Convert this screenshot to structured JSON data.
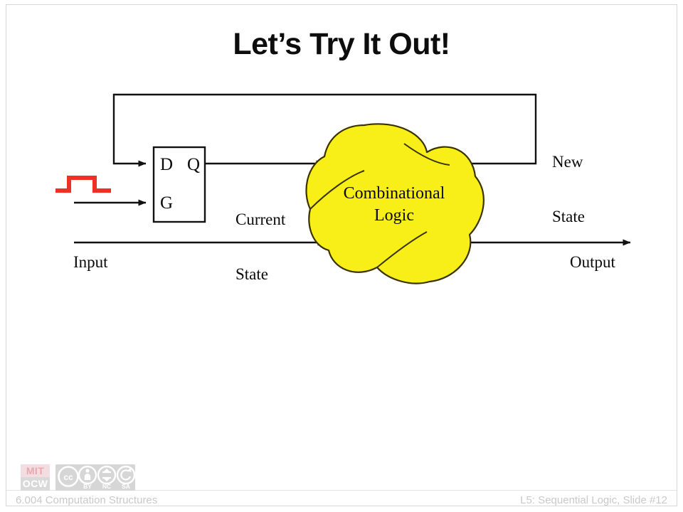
{
  "slide": {
    "title": "Let’s Try It Out!",
    "background_color": "#ffffff",
    "border_color": "#d8d8d8"
  },
  "diagram": {
    "name": "sequential-logic-block-diagram",
    "colors": {
      "wire": "#111111",
      "clock_pulse": "#ee3124",
      "blob_fill": "#f7ef17",
      "blob_stroke": "#3a3200",
      "register_stroke": "#111111"
    },
    "register": {
      "pin_d": "D",
      "pin_q": "Q",
      "pin_g": "G"
    },
    "combinational_logic": {
      "line1": "Combinational",
      "line2": "Logic"
    },
    "labels": {
      "new_state_line1": "New",
      "new_state_line2": "State",
      "current_state_line1": "Current",
      "current_state_line2": "State",
      "input": "Input",
      "output": "Output"
    }
  },
  "footer": {
    "course": "6.004 Computation Structures",
    "slide_ref": "L5: Sequential Logic, Slide #12",
    "mit_logo": {
      "line1": "MIT",
      "line2": "OCW"
    },
    "cc_license": {
      "mark": "CC",
      "terms": [
        "BY",
        "NC",
        "SA"
      ]
    },
    "text_color": "#c9c9c9"
  }
}
